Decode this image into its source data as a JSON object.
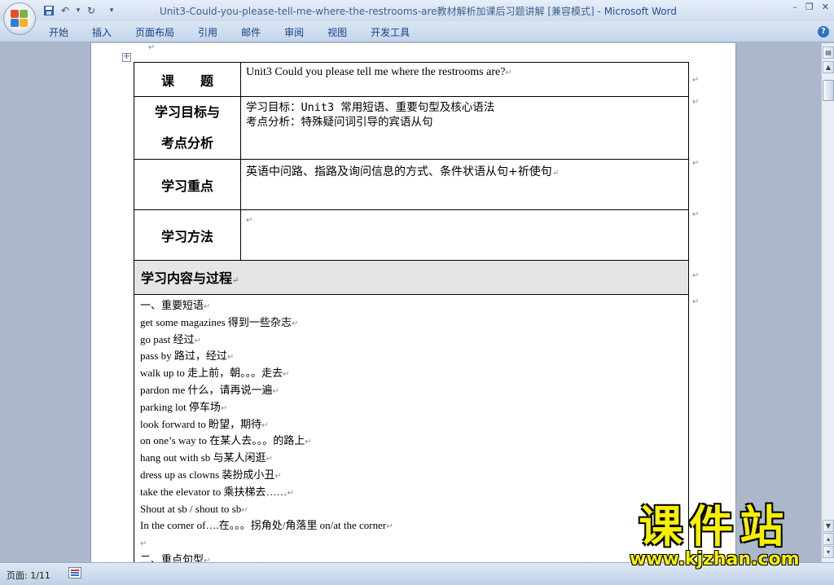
{
  "window": {
    "title": "Unit3-Could-you-please-tell-me-where-the-restrooms-are教材解析加课后习题讲解 [兼容模式] - ",
    "app_name": "Microsoft Word",
    "controls": [
      "–",
      "❐",
      "✕"
    ]
  },
  "quick_access": [
    {
      "name": "save-icon",
      "glyph": "▣"
    },
    {
      "name": "undo-icon",
      "glyph": "↶"
    },
    {
      "name": "dropdown-icon",
      "glyph": "▾"
    },
    {
      "name": "redo-icon",
      "glyph": "↻"
    },
    {
      "name": "customize-icon",
      "glyph": "="
    }
  ],
  "ribbon": {
    "tabs": [
      "开始",
      "插入",
      "页面布局",
      "引用",
      "邮件",
      "审阅",
      "视图",
      "开发工具"
    ],
    "help": "?"
  },
  "table": {
    "topic_label": "课　　题",
    "topic_value": "Unit3 Could you please tell me where the restrooms are?",
    "goals_label_1": "学习目标与",
    "goals_label_2": "考点分析",
    "goals_value_1": "学习目标：Unit3 常用短语、重要句型及核心语法",
    "goals_value_2": "考点分析：特殊疑问词引导的宾语从句",
    "focus_label": "学习重点",
    "focus_value": "英语中问路、指路及询问信息的方式、条件状语从句+祈使句",
    "method_label": "学习方法",
    "method_value": "",
    "section_title": "学习内容与过程",
    "content_lines": [
      "一、重要短语",
      "get some magazines  得到一些杂志",
      "go past  经过",
      "pass by 路过，经过",
      "walk up to  走上前，朝。。。走去",
      "pardon me  什么，请再说一遍",
      "parking lot  停车场",
      "look forward to 盼望，期待",
      "on one’s way to  在某人去。。。的路上",
      "hang out with sb 与某人闲逛",
      "dress up as clowns 装扮成小丑",
      "take the elevator to 乘扶梯去……",
      "Shout at sb /      shout to sb",
      "In the corner of….在。。。拐角处/角落里            on/at the corner",
      "",
      "二、重点句型"
    ]
  },
  "para_mark": "↵",
  "status": {
    "page": "页面: 1/11"
  },
  "watermark": {
    "title": "课件站",
    "url": "www.kjzhan.com"
  }
}
